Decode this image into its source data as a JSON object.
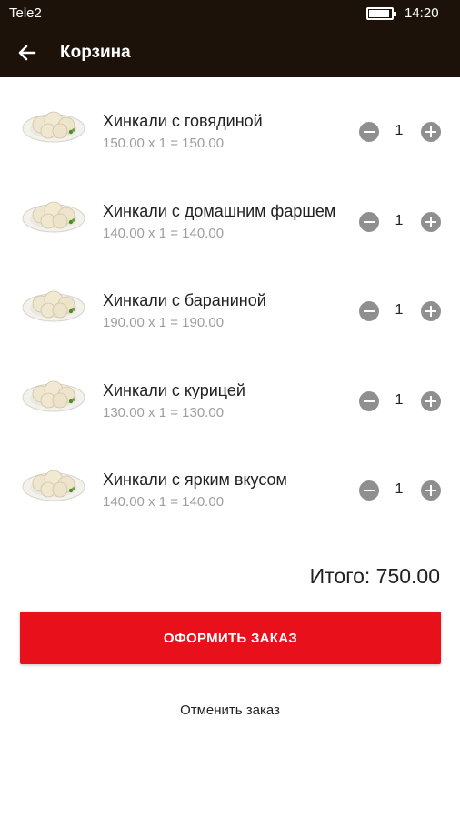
{
  "status_bar": {
    "carrier": "Tele2",
    "time": "14:20"
  },
  "toolbar": {
    "back_icon": "arrow-left-icon",
    "title": "Корзина"
  },
  "cart": {
    "items": [
      {
        "name": "Хинкали с говядиной",
        "price_line": "150.00 х 1 = 150.00",
        "quantity": "1"
      },
      {
        "name": "Хинкали с домашним фаршем",
        "price_line": "140.00 х 1 = 140.00",
        "quantity": "1"
      },
      {
        "name": "Хинкали с бараниной",
        "price_line": "190.00 х 1 = 190.00",
        "quantity": "1"
      },
      {
        "name": "Хинкали с курицей",
        "price_line": "130.00 х 1 = 130.00",
        "quantity": "1"
      },
      {
        "name": "Хинкали с ярким вкусом",
        "price_line": "140.00 х 1 = 140.00",
        "quantity": "1"
      }
    ],
    "total": "Итого: 750.00"
  },
  "actions": {
    "order_label": "ОФОРМИТЬ ЗАКАЗ",
    "cancel_label": "Отменить заказ"
  },
  "colors": {
    "toolbar_bg": "#1d1209",
    "accent": "#e8101a",
    "stepper_icon": "#8f8f8f",
    "secondary_text": "#9e9e9e"
  }
}
